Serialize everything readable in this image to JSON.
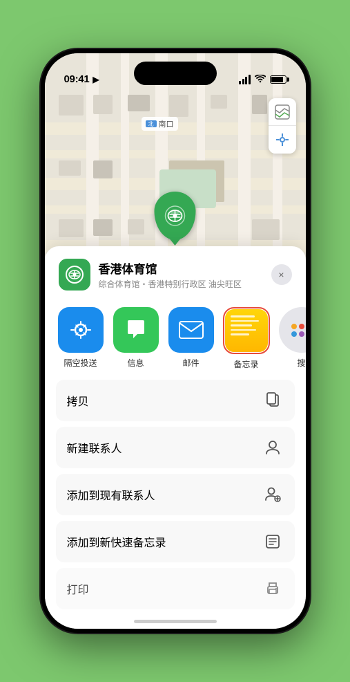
{
  "status_bar": {
    "time": "09:41",
    "location_arrow": "▶"
  },
  "map": {
    "label_text": "南口",
    "venue_marker_label": "香港体育馆",
    "map_type_icon": "🗺",
    "location_icon": "⬆"
  },
  "venue_info": {
    "name": "香港体育馆",
    "subtitle": "综合体育馆・香港特别行政区 油尖旺区",
    "close_label": "×"
  },
  "share_apps": [
    {
      "name": "airdrop",
      "label": "隔空投送"
    },
    {
      "name": "messages",
      "label": "信息"
    },
    {
      "name": "mail",
      "label": "邮件"
    },
    {
      "name": "notes",
      "label": "备忘录"
    },
    {
      "name": "more",
      "label": "搜"
    }
  ],
  "actions": [
    {
      "label": "拷贝",
      "icon": "copy"
    },
    {
      "label": "新建联系人",
      "icon": "person"
    },
    {
      "label": "添加到现有联系人",
      "icon": "person-add"
    },
    {
      "label": "添加到新快速备忘录",
      "icon": "quick-note"
    },
    {
      "label": "打印",
      "icon": "print"
    }
  ]
}
